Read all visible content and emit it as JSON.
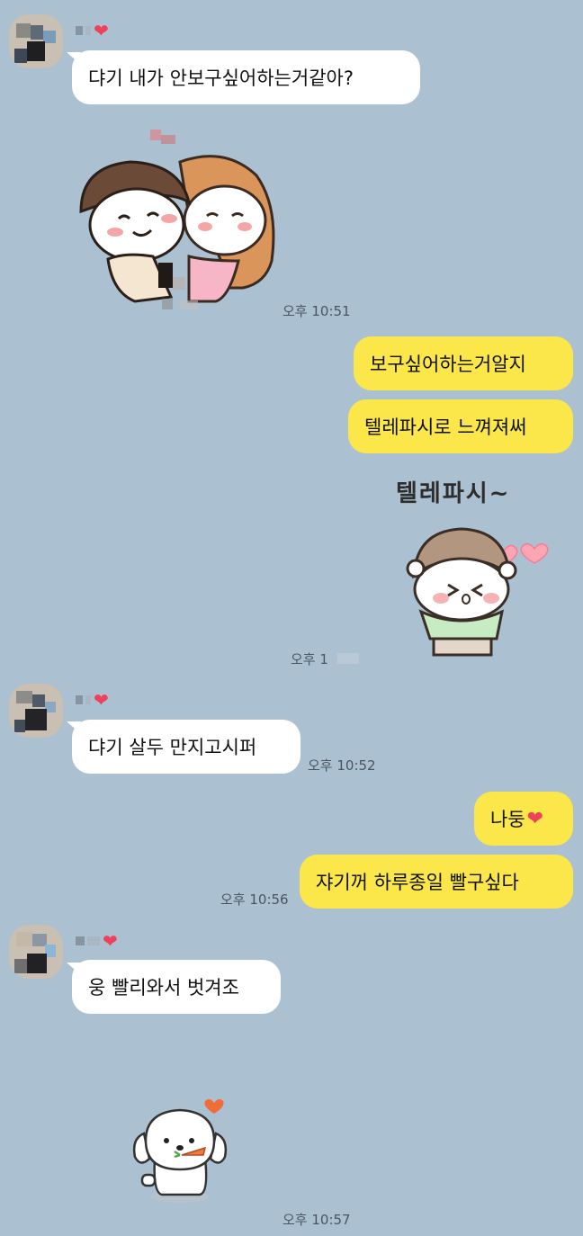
{
  "messages": {
    "m1": {
      "text": "댜기 내가 안보구싶어하는거같아?"
    },
    "m1_time": "오후 10:51",
    "m2": {
      "text": "보구싶어하는거알지"
    },
    "m3": {
      "text": "텔레파시로 느껴져써"
    },
    "sticker2_text": "텔레파시~",
    "m3_time": "오후 1",
    "m4": {
      "text": "댜기 살두 만지고시퍼"
    },
    "m4_time": "오후 10:52",
    "m5": {
      "text": "나둥"
    },
    "m6": {
      "text": "쟈기꺼 하루종일 빨구싶다"
    },
    "m6_time": "오후 10:56",
    "m7": {
      "text": "웅 빨리와서 벗겨조"
    },
    "m7_time": "오후 10:57"
  },
  "icons": {
    "heart": "❤",
    "name_heart_color": "#f0405a"
  },
  "colors": {
    "background": "#abc1d1",
    "incoming_bubble": "#ffffff",
    "outgoing_bubble": "#fbe74a"
  }
}
